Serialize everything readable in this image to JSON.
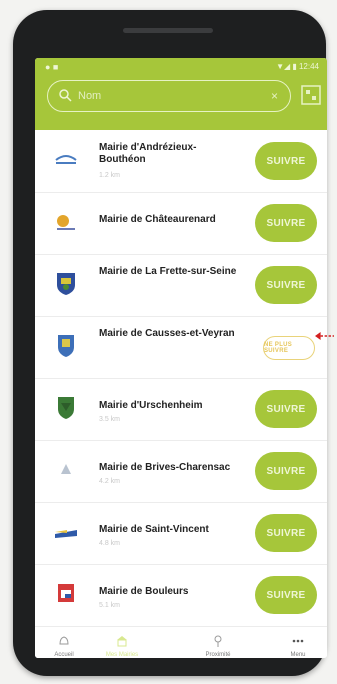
{
  "status": {
    "left": "● ■",
    "right": "▼◢ ▮ 12:44"
  },
  "search": {
    "placeholder": "Nom",
    "clear": "×"
  },
  "rows": [
    {
      "name": "Mairie d'Andrézieux-Bouthéon",
      "sub": "1.2 km",
      "button": "SUIVRE"
    },
    {
      "name": "Mairie de Châteaurenard",
      "sub": "",
      "button": "SUIVRE"
    },
    {
      "name": "Mairie de La Frette-sur-Seine",
      "sub": "",
      "button": "SUIVRE"
    },
    {
      "name": "Mairie de Causses-et-Veyran",
      "sub": "",
      "button": "NE PLUS SUIVRE"
    },
    {
      "name": "Mairie d'Urschenheim",
      "sub": "3.5 km",
      "button": "SUIVRE"
    },
    {
      "name": "Mairie de Brives-Charensac",
      "sub": "4.2 km",
      "button": "SUIVRE"
    },
    {
      "name": "Mairie de Saint-Vincent",
      "sub": "4.8 km",
      "button": "SUIVRE"
    },
    {
      "name": "Mairie de Bouleurs",
      "sub": "5.1 km",
      "button": "SUIVRE"
    }
  ],
  "nav": [
    {
      "label": "Accueil",
      "icon": "bell-icon"
    },
    {
      "label": "Mes Mairies",
      "icon": "townhall-icon"
    },
    {
      "label": "Proximité",
      "icon": "location-icon"
    },
    {
      "label": "Menu",
      "icon": "more-icon"
    }
  ],
  "colors": {
    "accent": "#a6c63a",
    "arrow": "#d32020"
  }
}
